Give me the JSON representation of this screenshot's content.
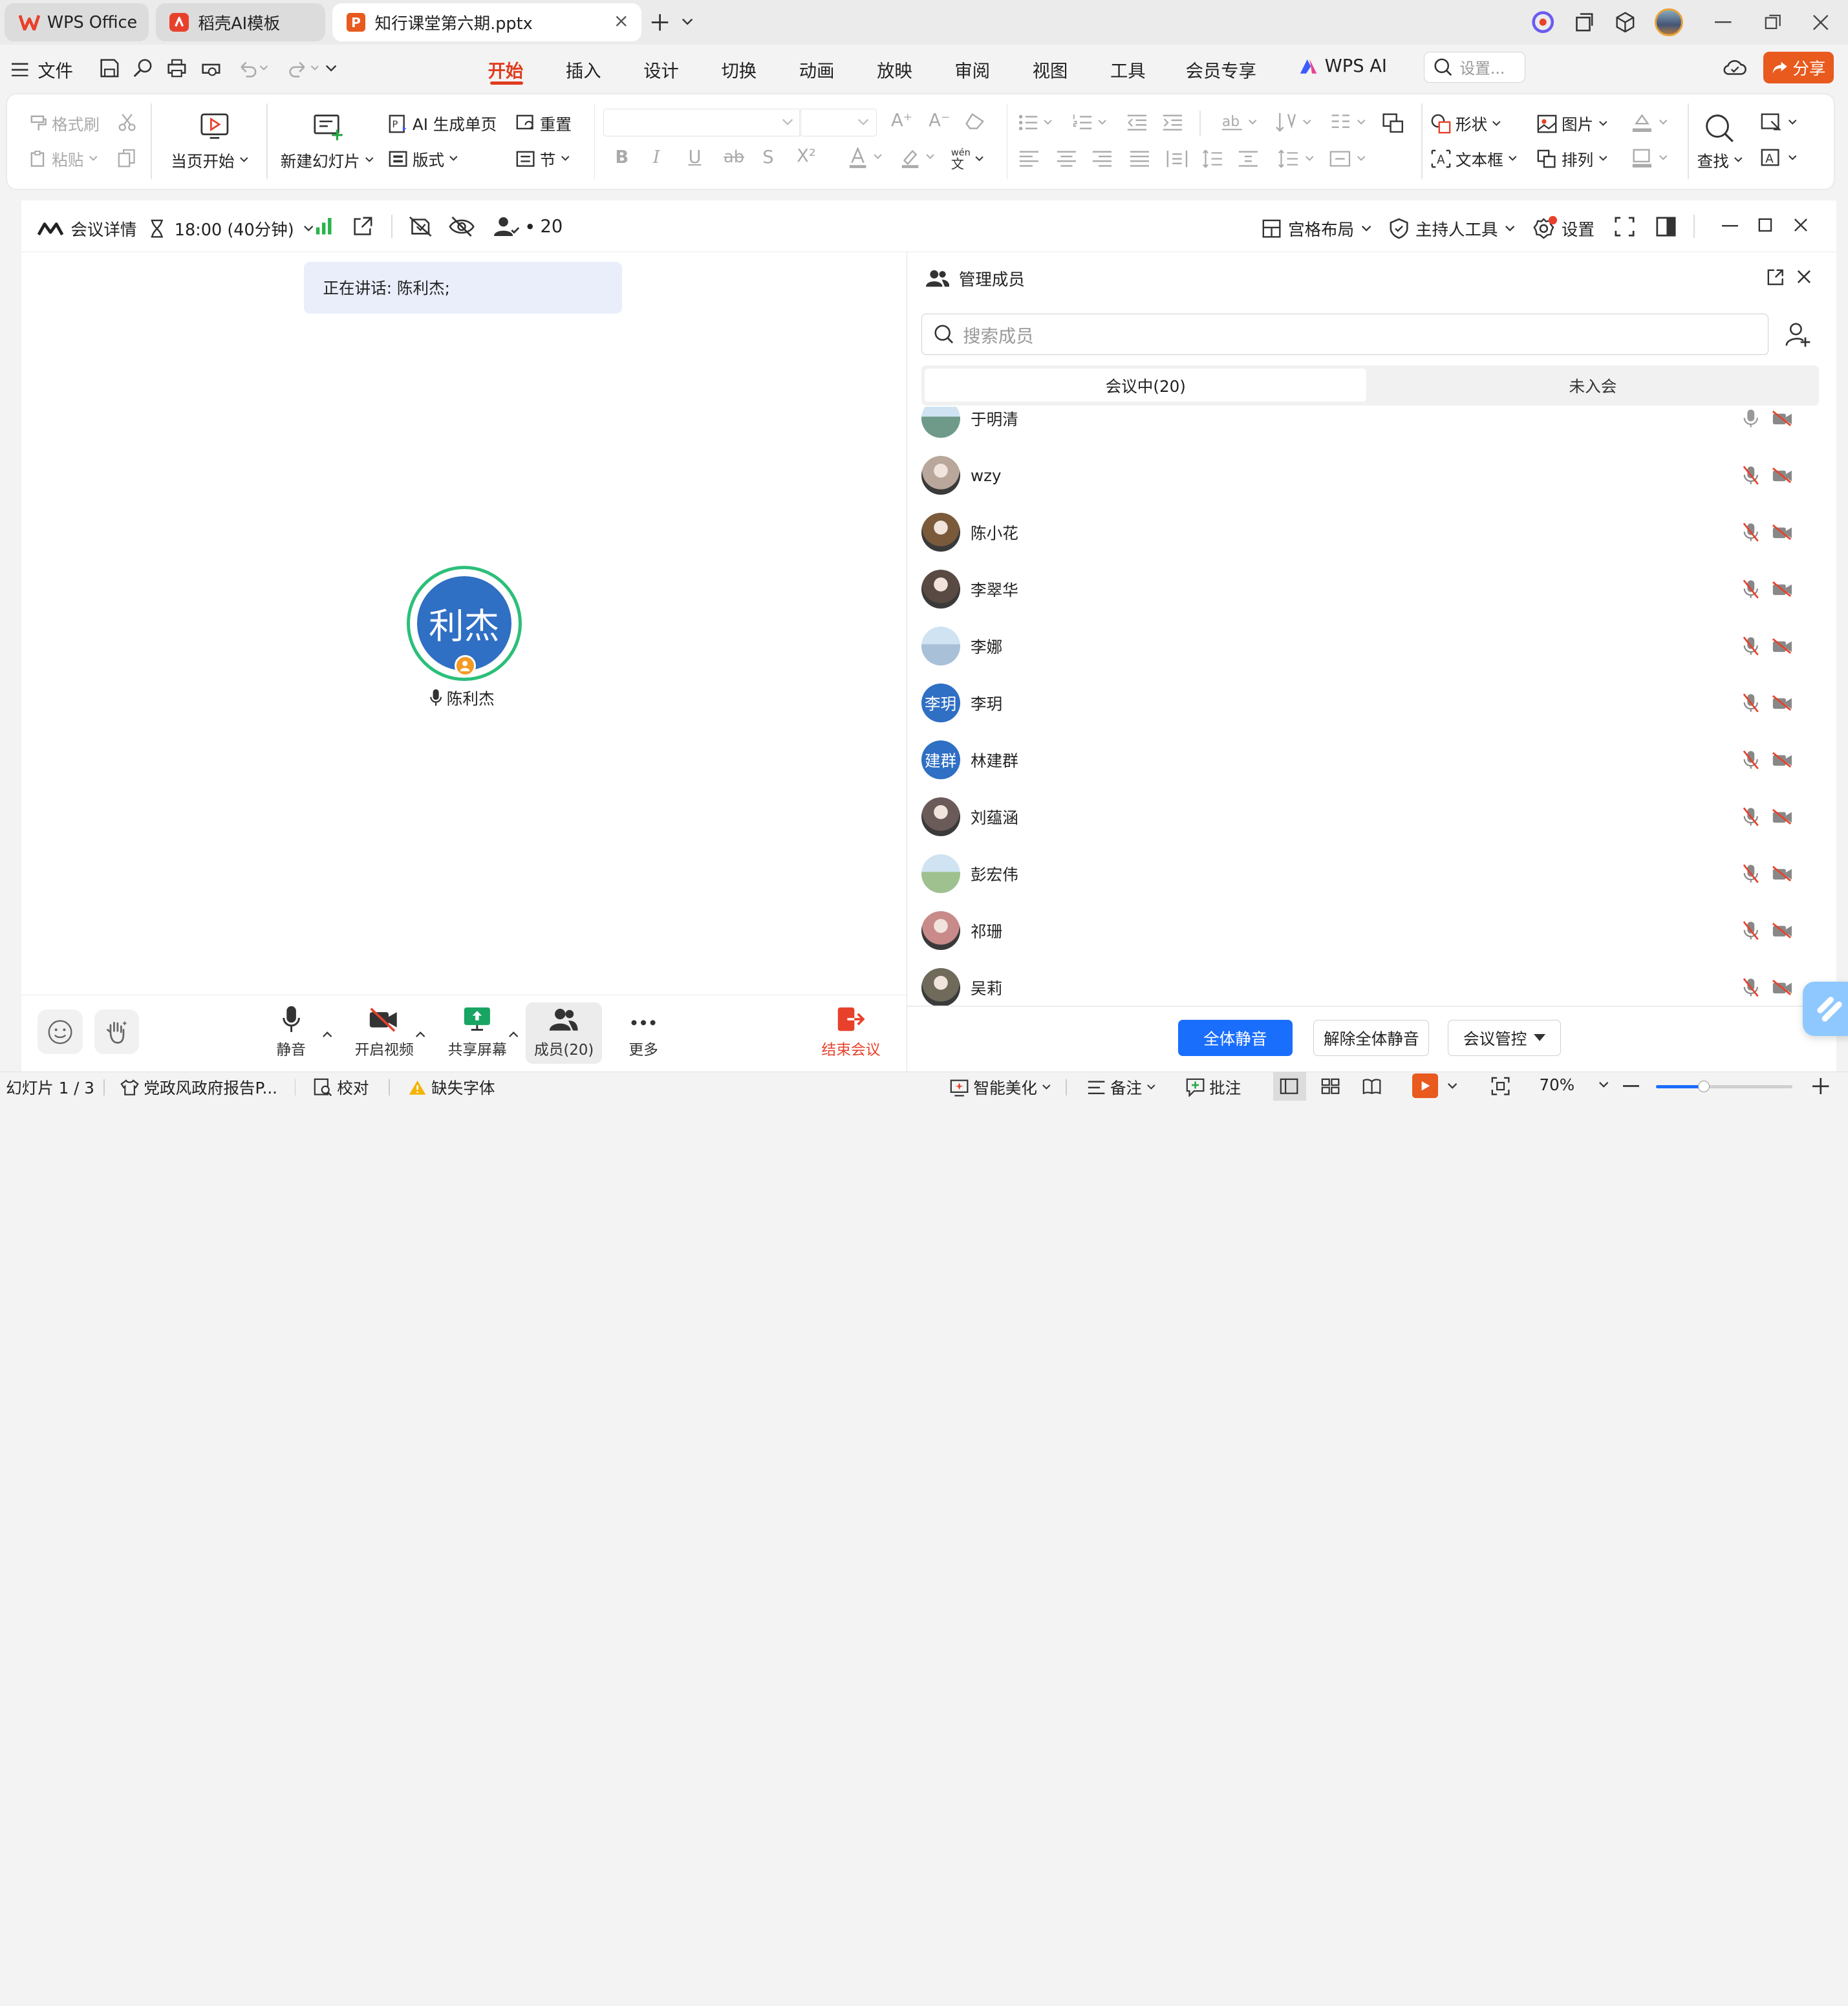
{
  "tabs": [
    {
      "label": "WPS Office"
    },
    {
      "label": "稻壳AI模板"
    },
    {
      "label": "知行课堂第六期.pptx"
    }
  ],
  "menu": {
    "file": "文件",
    "items": [
      "开始",
      "插入",
      "设计",
      "切换",
      "动画",
      "放映",
      "审阅",
      "视图",
      "工具",
      "会员专享"
    ],
    "wps_ai": "WPS AI",
    "search_placeholder": "设置...",
    "share": "分享"
  },
  "ribbon": {
    "format_painter": "格式刷",
    "paste": "粘贴",
    "play_current": "当页开始",
    "new_slide": "新建幻灯片",
    "ai_generate": "AI 生成单页",
    "layout": "版式",
    "reset": "重置",
    "section": "节",
    "shape": "形状",
    "picture": "图片",
    "textbox": "文本框",
    "arrange": "排列",
    "find": "查找"
  },
  "meeting": {
    "details": "会议详情",
    "time": "18:00 (40分钟)",
    "participant_count": "20",
    "layout": "宫格布局",
    "host_tools": "主持人工具",
    "settings": "设置",
    "speaking_banner": "正在讲话: 陈利杰;",
    "speaker_avatar_text": "利杰",
    "speaker_name": "陈利杰"
  },
  "controls": {
    "mute": "静音",
    "video": "开启视频",
    "share": "共享屏幕",
    "members": "成员(20)",
    "more": "更多",
    "end": "结束会议"
  },
  "panel": {
    "title": "管理成员",
    "search_placeholder": "搜索成员",
    "tab_in": "会议中(20)",
    "tab_out": "未入会",
    "mute_all": "全体静音",
    "unmute_all": "解除全体静音",
    "control": "会议管控"
  },
  "members": [
    {
      "name": "于明清",
      "avatar": "landscape-photo",
      "color": "#6f9a8a"
    },
    {
      "name": "wzy",
      "avatar": "dog-photo",
      "color": "#b8a79a"
    },
    {
      "name": "陈小花",
      "avatar": "house-photo",
      "color": "#7a5a3a"
    },
    {
      "name": "李翠华",
      "avatar": "person-photo",
      "color": "#5a4a44"
    },
    {
      "name": "李娜",
      "avatar": "sky-photo",
      "color": "#a8c0d8"
    },
    {
      "name": "李玥",
      "avatar": "李玥",
      "color": "#2f6fc4"
    },
    {
      "name": "林建群",
      "avatar": "建群",
      "color": "#2f6fc4"
    },
    {
      "name": "刘蕴涵",
      "avatar": "person-photo",
      "color": "#6a5a58"
    },
    {
      "name": "彭宏伟",
      "avatar": "flower-photo",
      "color": "#9fc08f"
    },
    {
      "name": "祁珊",
      "avatar": "person-photo",
      "color": "#c98a8a"
    },
    {
      "name": "吴莉",
      "avatar": "person-photo",
      "color": "#6f6a5a"
    }
  ],
  "status": {
    "slide": "幻灯片 1 / 3",
    "template": "党政风政府报告P...",
    "proofread": "校对",
    "missing_font": "缺失字体",
    "beautify": "智能美化",
    "notes": "备注",
    "comment": "批注",
    "zoom": "70%"
  },
  "colors": {
    "accent": "#e03c1f",
    "primary": "#1a6efc",
    "end": "#e8412b",
    "avatar_blue": "#2f6fc4"
  }
}
